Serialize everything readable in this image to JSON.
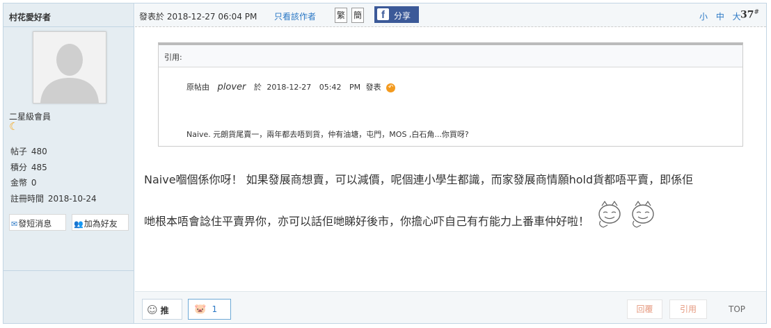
{
  "author": {
    "name": "村花愛好者",
    "rank": "二星級會員",
    "rank_icon": "crescent-moon-icon",
    "stats": [
      {
        "label": "帖子",
        "value": "480"
      },
      {
        "label": "積分",
        "value": "485"
      },
      {
        "label": "金幣",
        "value": "0"
      },
      {
        "label": "註冊時間",
        "value": "2018-10-24"
      }
    ],
    "send_message_label": "發短消息",
    "add_friend_label": "加為好友"
  },
  "header": {
    "posted_at": "發表於 2018-12-27 06:04 PM",
    "only_author": "只看該作者",
    "traditional": "繁",
    "simplified": "簡",
    "share_label": "分享",
    "font_size": "小 中 大",
    "floor": "37",
    "floor_sup": "#"
  },
  "quote": {
    "heading": "引用:",
    "from_prefix": "原帖由",
    "from_user": "plover",
    "from_in": "於",
    "from_date": "2018-12-27",
    "from_time": "05:42",
    "from_ampm": "PM",
    "from_suffix": "發表",
    "body": "Naive.  元朗貨尾賣一，兩年都去唔到貨，仲有油塘，屯門，MOS  ,白石角...你買呀?"
  },
  "content": {
    "line1": "Naive嗰個係你呀！  如果發展商想賣，可以減價，呢個連小學生都識，而家發展商情願hold貨都唔平賣，即係佢",
    "line2": "哋根本唔會諗住平賣畀你，亦可以話佢哋睇好後市，你擔心吓自己有冇能力上番車仲好啦！"
  },
  "footer": {
    "vote_up_label": "推",
    "vote_down_count": "1",
    "reply_label": "回覆",
    "quote_label": "引用",
    "top_label": "TOP"
  },
  "colors": {
    "sidebar_bg": "#e5edf2",
    "header_bg": "#f4f7f9",
    "link_blue": "#2b78c5",
    "facebook": "#3b5998"
  }
}
